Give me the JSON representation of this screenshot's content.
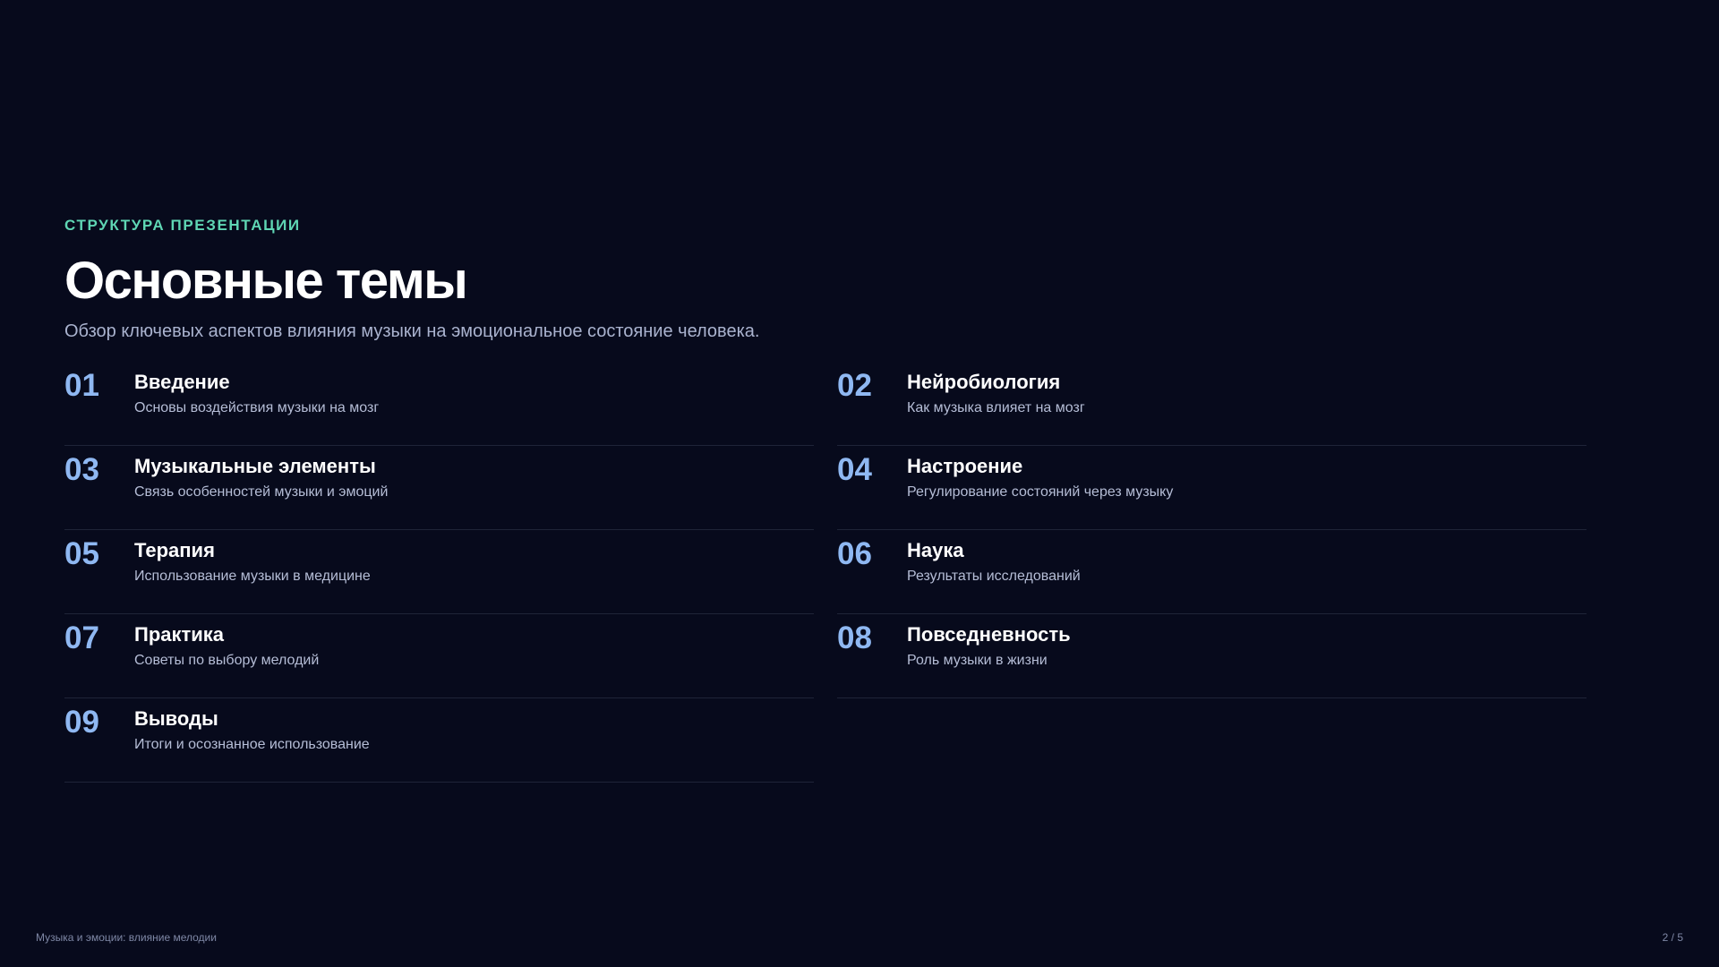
{
  "header": {
    "eyebrow": "СТРУКТУРА ПРЕЗЕНТАЦИИ",
    "title": "Основные темы",
    "subtitle": "Обзор ключевых аспектов влияния музыки на эмоциональное состояние человека."
  },
  "topics": [
    {
      "num": "01",
      "title": "Введение",
      "desc": "Основы воздействия музыки на мозг"
    },
    {
      "num": "02",
      "title": "Нейробиология",
      "desc": "Как музыка влияет на мозг"
    },
    {
      "num": "03",
      "title": "Музыкальные элементы",
      "desc": "Связь особенностей музыки и эмоций"
    },
    {
      "num": "04",
      "title": "Настроение",
      "desc": "Регулирование состояний через музыку"
    },
    {
      "num": "05",
      "title": "Терапия",
      "desc": "Использование музыки в медицине"
    },
    {
      "num": "06",
      "title": "Наука",
      "desc": "Результаты исследований"
    },
    {
      "num": "07",
      "title": "Практика",
      "desc": "Советы по выбору мелодий"
    },
    {
      "num": "08",
      "title": "Повседневность",
      "desc": "Роль музыки в жизни"
    },
    {
      "num": "09",
      "title": "Выводы",
      "desc": "Итоги и осознанное использование"
    }
  ],
  "footer": {
    "left": "Музыка и эмоции: влияние мелодии",
    "right": "2 / 5"
  },
  "colors": {
    "background": "#070a1c",
    "accent": "#5fd6b4",
    "number": "#8fb8f2",
    "divider": "#1f2438"
  }
}
